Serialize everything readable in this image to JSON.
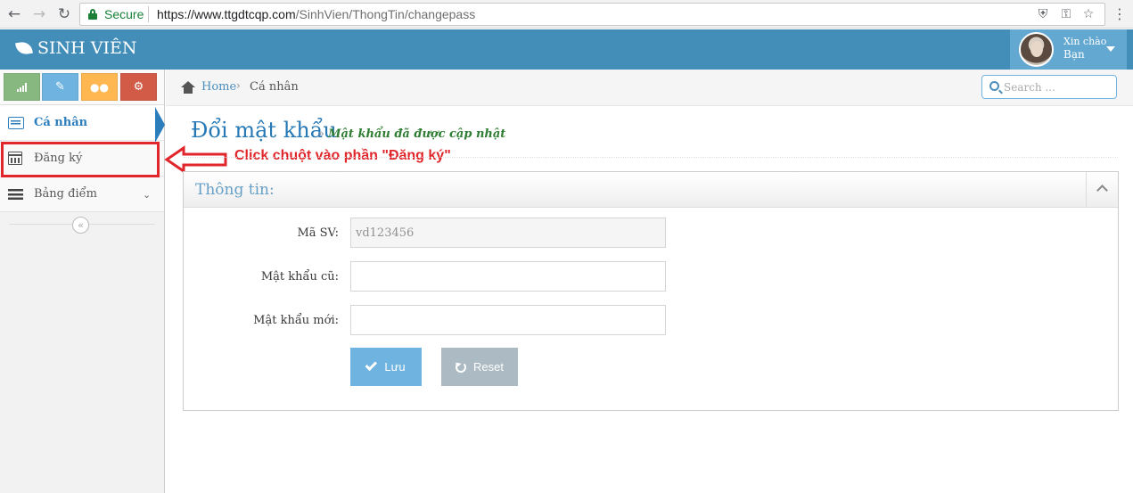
{
  "browser": {
    "secure_label": "Secure",
    "url_host": "https://www.ttgdtcqp.com",
    "url_path": "/SinhVien/ThongTin/changepass"
  },
  "header": {
    "brand": "SINH VIÊN",
    "greeting": "Xin chào",
    "user_name": "Bạn"
  },
  "shortcut_colors": [
    "#87b87f",
    "#6fb3e0",
    "#ffb752",
    "#d15b47"
  ],
  "sidebar": {
    "items": [
      {
        "label": "Cá nhân"
      },
      {
        "label": "Đăng ký"
      },
      {
        "label": "Bảng điểm"
      }
    ]
  },
  "annotation": {
    "text": "Click chuột vào phần \"Đăng ký\""
  },
  "breadcrumbs": {
    "home": "Home",
    "current": "Cá nhân"
  },
  "search": {
    "placeholder": "Search ..."
  },
  "page": {
    "title": "Đổi mật khẩu",
    "sub_prefix": "»",
    "message": "Mật khẩu đã được cập nhật"
  },
  "widget": {
    "title": "Thông tin:"
  },
  "form": {
    "student_id_label": "Mã SV:",
    "student_id_value": "vd123456",
    "old_password_label": "Mật khẩu cũ:",
    "old_password_value": "",
    "new_password_label": "Mật khẩu mới:",
    "new_password_value": "",
    "save_label": "Lưu",
    "reset_label": "Reset"
  }
}
